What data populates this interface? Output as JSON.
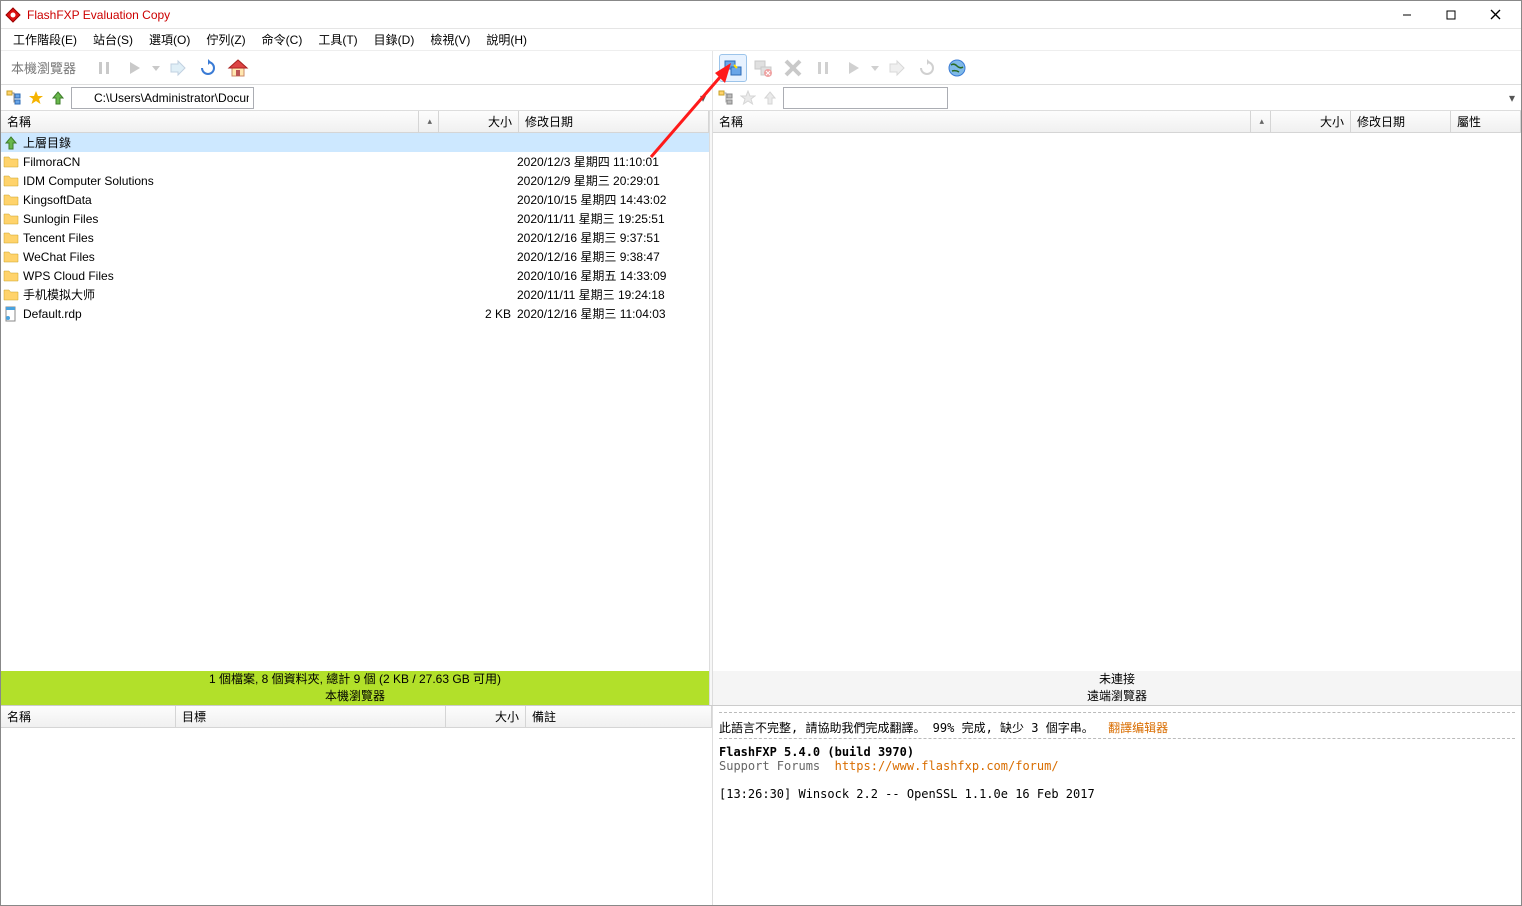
{
  "app": {
    "title": "FlashFXP Evaluation Copy"
  },
  "menu": [
    "工作階段(E)",
    "站台(S)",
    "選項(O)",
    "佇列(Z)",
    "命令(C)",
    "工具(T)",
    "目錄(D)",
    "檢視(V)",
    "說明(H)"
  ],
  "toolbar": {
    "local_label": "本機瀏覽器"
  },
  "address": {
    "path": "C:\\Users\\Administrator\\Documents"
  },
  "local": {
    "cols": {
      "name": "名稱",
      "size": "大小",
      "date": "修改日期"
    },
    "parent": "上層目錄",
    "rows": [
      {
        "n": "FilmoraCN",
        "s": "",
        "d": "2020/12/3 星期四 11:10:01",
        "t": "folder"
      },
      {
        "n": "IDM Computer Solutions",
        "s": "",
        "d": "2020/12/9 星期三 20:29:01",
        "t": "folder"
      },
      {
        "n": "KingsoftData",
        "s": "",
        "d": "2020/10/15 星期四 14:43:02",
        "t": "folder"
      },
      {
        "n": "Sunlogin Files",
        "s": "",
        "d": "2020/11/11 星期三 19:25:51",
        "t": "folder"
      },
      {
        "n": "Tencent Files",
        "s": "",
        "d": "2020/12/16 星期三 9:37:51",
        "t": "folder"
      },
      {
        "n": "WeChat Files",
        "s": "",
        "d": "2020/12/16 星期三 9:38:47",
        "t": "folder"
      },
      {
        "n": "WPS Cloud Files",
        "s": "",
        "d": "2020/10/16 星期五 14:33:09",
        "t": "folder"
      },
      {
        "n": "手机模拟大师",
        "s": "",
        "d": "2020/11/11 星期三 19:24:18",
        "t": "folder"
      },
      {
        "n": "Default.rdp",
        "s": "2 KB",
        "d": "2020/12/16 星期三 11:04:03",
        "t": "file"
      }
    ],
    "status": "1 個檔案, 8 個資料夾, 總計 9 個 (2 KB / 27.63 GB 可用)",
    "panelabel": "本機瀏覽器"
  },
  "remote": {
    "cols": {
      "name": "名稱",
      "size": "大小",
      "date": "修改日期",
      "attr": "屬性"
    },
    "status": "未連接",
    "panelabel": "遠端瀏覽器"
  },
  "queue": {
    "cols": {
      "name": "名稱",
      "target": "目標",
      "size": "大小",
      "note": "備註"
    }
  },
  "log": {
    "lang_note": "此語言不完整, 請協助我們完成翻譯。 99% 完成, 缺少 3 個字串。",
    "lang_link": "翻譯编辑器",
    "product": "FlashFXP 5.4.0 (build 3970)",
    "forum_label": "Support Forums",
    "forum_url": "https://www.flashfxp.com/forum/",
    "line": "[13:26:30]  Winsock 2.2 -- OpenSSL 1.1.0e  16 Feb 2017"
  }
}
